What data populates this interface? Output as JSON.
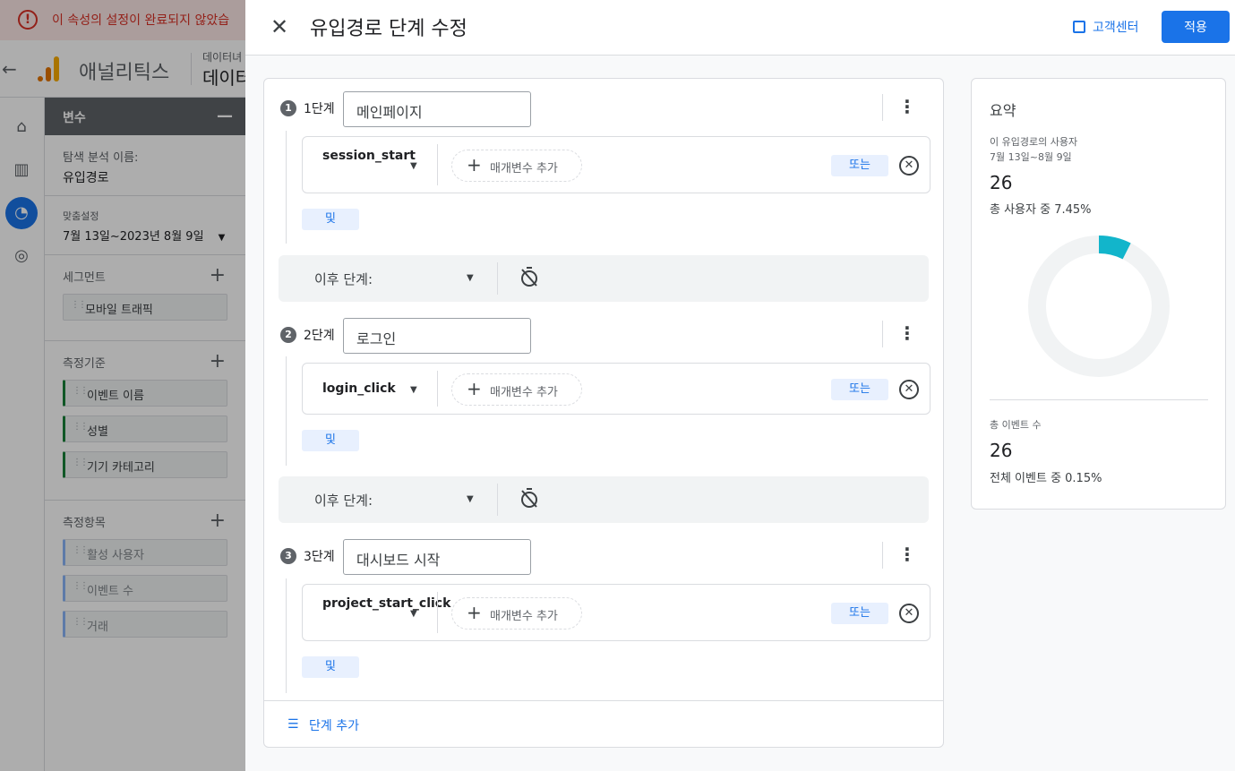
{
  "colors": {
    "accent": "#1a73e8",
    "error": "#d93025",
    "donut_fill": "#12b5cb",
    "donut_track": "#f1f3f4"
  },
  "background": {
    "alert_text": "이 속성의 설정이 완료되지 않았습",
    "brand": "애널리틱스",
    "crumb_sub": "데이터녀",
    "crumb_main": "데이터",
    "rail_icons": [
      "home-icon",
      "reports-icon",
      "explore-icon",
      "advertising-icon"
    ],
    "variables": {
      "header": "변수",
      "exploration_label": "탐색 분석 이름:",
      "exploration_name": "유입경로",
      "custom_label": "맞춤설정",
      "date_range": "7월 13일~2023년 8월 9일",
      "segments_label": "세그먼트",
      "segments": [
        "모바일 트래픽"
      ],
      "dimensions_label": "측정기준",
      "dimensions": [
        "이벤트 이름",
        "성별",
        "기기 카테고리"
      ],
      "metrics_label": "측정항목",
      "metrics": [
        "활성 사용자",
        "이벤트 수",
        "거래"
      ]
    }
  },
  "dialog": {
    "title": "유입경로 단계 수정",
    "help_label": "고객센터",
    "apply_label": "적용",
    "next_step_label": "이후 단계:",
    "add_step_label": "단계 추가",
    "param_label": "매개변수 추가",
    "or_label": "또는",
    "and_label": "및",
    "steps": [
      {
        "number": "1",
        "label": "1단계",
        "name": "메인페이지",
        "event": "session_start"
      },
      {
        "number": "2",
        "label": "2단계",
        "name": "로그인",
        "event": "login_click"
      },
      {
        "number": "3",
        "label": "3단계",
        "name": "대시보드 시작",
        "event": "project_start_click"
      }
    ]
  },
  "summary": {
    "title": "요약",
    "users_label": "이 유입경로의 사용자",
    "date_range": "7월 13일~8월 9일",
    "users_value": "26",
    "users_share": "총 사용자 중 7.45%",
    "users_share_pct": 7.45,
    "events_label": "총 이벤트 수",
    "events_value": "26",
    "events_share": "전체 이벤트 중 0.15%"
  }
}
